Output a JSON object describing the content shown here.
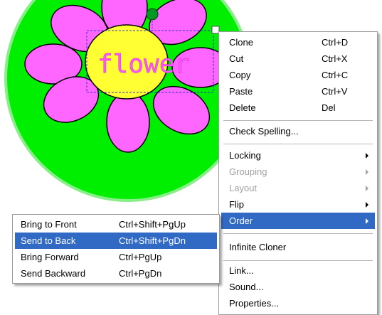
{
  "canvas": {
    "flower_text": "flower",
    "colors": {
      "background_circle": "#00ee00",
      "petal": "#ff66ff",
      "center": "#ffff33",
      "text": "#ff55ff",
      "knob": "#009922"
    }
  },
  "context_menu": {
    "items": [
      {
        "label": "Clone",
        "shortcut": "Ctrl+D"
      },
      {
        "label": "Cut",
        "shortcut": "Ctrl+X"
      },
      {
        "label": "Copy",
        "shortcut": "Ctrl+C"
      },
      {
        "label": "Paste",
        "shortcut": "Ctrl+V"
      },
      {
        "label": "Delete",
        "shortcut": "Del"
      },
      {
        "label": "Check Spelling..."
      },
      {
        "label": "Locking"
      },
      {
        "label": "Grouping"
      },
      {
        "label": "Layout"
      },
      {
        "label": "Flip"
      },
      {
        "label": "Order"
      },
      {
        "label": "Infinite Cloner"
      },
      {
        "label": "Link..."
      },
      {
        "label": "Sound..."
      },
      {
        "label": "Properties..."
      }
    ]
  },
  "order_submenu": {
    "items": [
      {
        "label": "Bring to Front",
        "shortcut": "Ctrl+Shift+PgUp"
      },
      {
        "label": "Send to Back",
        "shortcut": "Ctrl+Shift+PgDn"
      },
      {
        "label": "Bring Forward",
        "shortcut": "Ctrl+PgUp"
      },
      {
        "label": "Send Backward",
        "shortcut": "Ctrl+PgDn"
      }
    ]
  },
  "highlight_color": "#316ac5"
}
